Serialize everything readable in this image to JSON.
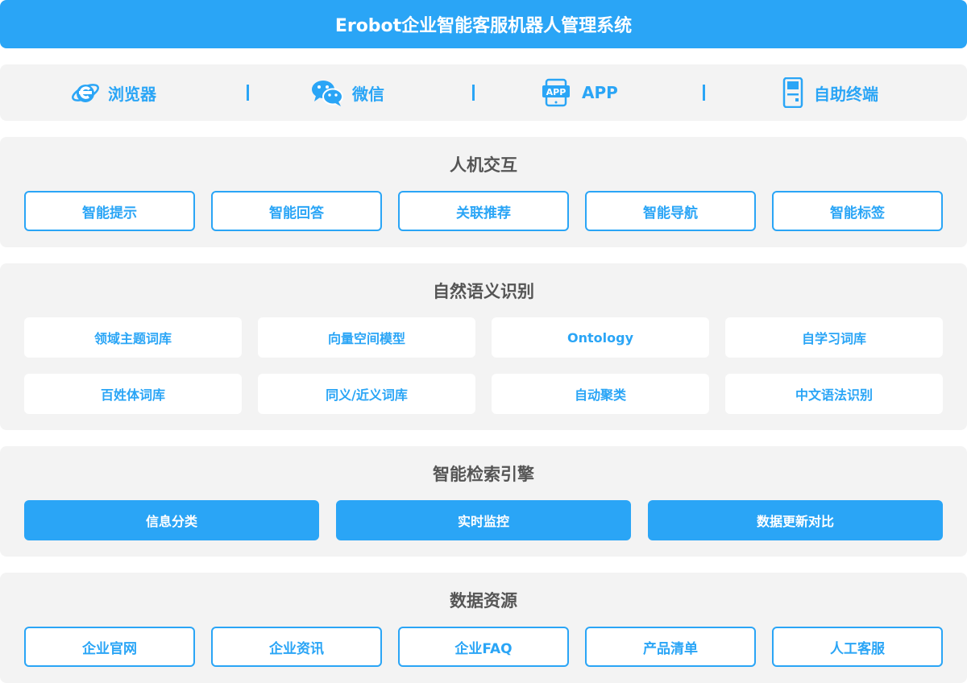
{
  "title": "Erobot企业智能客服机器人管理系统",
  "colors": {
    "accent": "#2aa5f6",
    "panel": "#f3f3f3",
    "heading": "#555555"
  },
  "channels": [
    {
      "icon": "ie-browser-icon",
      "label": "浏览器"
    },
    {
      "icon": "wechat-icon",
      "label": "微信"
    },
    {
      "icon": "app-icon",
      "label": "APP"
    },
    {
      "icon": "kiosk-terminal-icon",
      "label": "自助终端"
    }
  ],
  "interaction": {
    "title": "人机交互",
    "items": [
      "智能提示",
      "智能回答",
      "关联推荐",
      "智能导航",
      "智能标签"
    ]
  },
  "nlp": {
    "title": "自然语义识别",
    "items": [
      "领域主题词库",
      "向量空间模型",
      "Ontology",
      "自学习词库",
      "百姓体词库",
      "同义/近义词库",
      "自动聚类",
      "中文语法识别"
    ]
  },
  "search": {
    "title": "智能检索引擎",
    "items": [
      "信息分类",
      "实时监控",
      "数据更新对比"
    ]
  },
  "data_sources": {
    "title": "数据资源",
    "items": [
      "企业官网",
      "企业资讯",
      "企业FAQ",
      "产品清单",
      "人工客服"
    ]
  }
}
